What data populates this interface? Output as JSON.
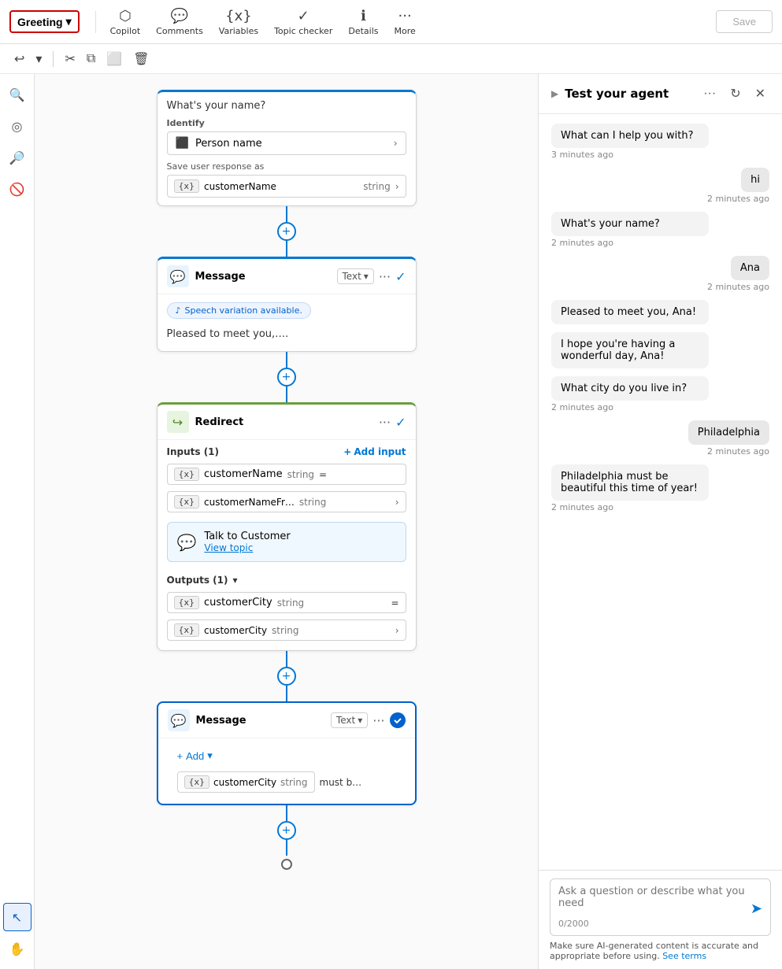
{
  "toolbar": {
    "greeting_label": "Greeting",
    "copilot_label": "Copilot",
    "comments_label": "Comments",
    "variables_label": "Variables",
    "topic_checker_label": "Topic checker",
    "details_label": "Details",
    "more_label": "More",
    "save_label": "Save"
  },
  "undoredo": {
    "undo_label": "↺",
    "redo_label": "↻",
    "cut_label": "✂",
    "copy_label": "⧉",
    "paste_label": "⬜",
    "delete_label": "🗑"
  },
  "canvas": {
    "question_node": {
      "question_text": "What's your name?",
      "identify_label": "Identify",
      "identify_value": "Person name",
      "save_response_label": "Save user response as",
      "var_name": "customerName",
      "var_type": "string"
    },
    "message_node1": {
      "title": "Message",
      "text_label": "Text",
      "speech_badge": "Speech variation available.",
      "message_text": "Pleased to meet you,…."
    },
    "redirect_node": {
      "title": "Redirect",
      "inputs_label": "Inputs (1)",
      "add_input_label": "Add input",
      "input_var": "customerName",
      "input_type": "string",
      "input_var2": "customerNameFr…",
      "input_type2": "string",
      "talk_title": "Talk to Customer",
      "view_topic_label": "View topic",
      "outputs_label": "Outputs (1)",
      "output_var": "customerCity",
      "output_type": "string",
      "output_var2": "customerCity",
      "output_type2": "string"
    },
    "message_node2": {
      "title": "Message",
      "text_label": "Text",
      "add_label": "Add",
      "chip_var": "customerCity",
      "chip_type": "string",
      "chip_text": "must b…"
    }
  },
  "right_panel": {
    "title": "Test your agent",
    "chat": [
      {
        "type": "left",
        "text": "What can I help you with?",
        "time": "3 minutes ago"
      },
      {
        "type": "right",
        "text": "hi",
        "time": "2 minutes ago"
      },
      {
        "type": "left",
        "text": "What's your name?",
        "time": "2 minutes ago"
      },
      {
        "type": "right",
        "text": "Ana",
        "time": "2 minutes ago"
      },
      {
        "type": "left",
        "text": "Pleased to meet you, Ana!",
        "time": ""
      },
      {
        "type": "left",
        "text": "I hope you're having a wonderful day, Ana!",
        "time": ""
      },
      {
        "type": "left",
        "text": "What city do you live in?",
        "time": "2 minutes ago"
      },
      {
        "type": "right",
        "text": "Philadelphia",
        "time": "2 minutes ago"
      },
      {
        "type": "left",
        "text": "Philadelphia must be beautiful this time of year!",
        "time": "2 minutes ago"
      }
    ],
    "input_placeholder": "Ask a question or describe what you need",
    "char_count": "0/2000",
    "disclaimer": "Make sure AI-generated content is accurate and appropriate before using.",
    "see_terms": "See terms"
  },
  "sidebar_icons": [
    "zoom-in-icon",
    "target-icon",
    "zoom-out-icon",
    "block-icon",
    "cursor-icon",
    "hand-icon"
  ]
}
